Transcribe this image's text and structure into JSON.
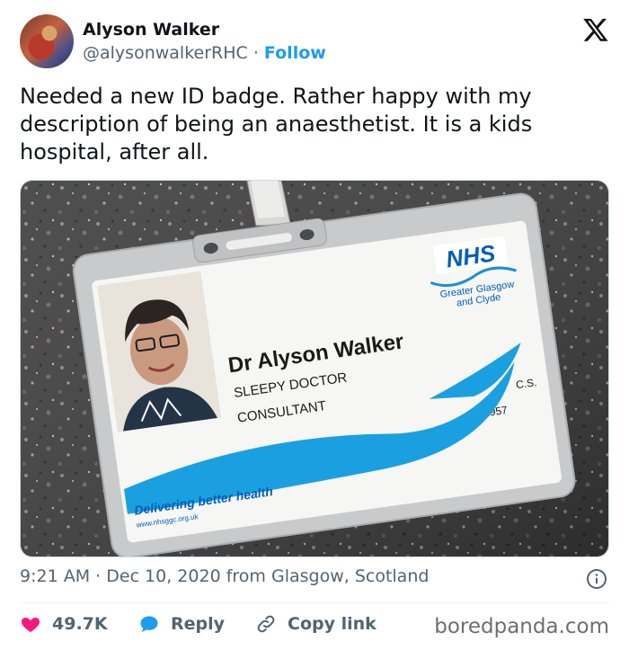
{
  "author": {
    "name": "Alyson Walker",
    "handle": "@alysonwalkerRHC",
    "separator": "·",
    "follow_label": "Follow"
  },
  "tweet": {
    "text": "Needed a new ID badge.  Rather happy with my description of being an anaesthetist. It is a kids hospital, after all."
  },
  "badge": {
    "org": "NHS",
    "org_sub_line1": "Greater Glasgow",
    "org_sub_line2": "and Clyde",
    "holder_name": "Dr Alyson Walker",
    "role_line1": "SLEEPY DOCTOR",
    "role_line2": "CONSULTANT",
    "code": "C.S.",
    "number": "1957",
    "slogan": "Delivering better health",
    "website": "www.nhsggc.org.uk"
  },
  "meta": {
    "time": "9:21 AM",
    "separator": "·",
    "date": "Dec 10, 2020",
    "location": "from Glasgow, Scotland"
  },
  "actions": {
    "likes": "49.7K",
    "reply_label": "Reply",
    "copy_label": "Copy link"
  },
  "watermark": "boredpanda.com",
  "colors": {
    "like": "#f91880",
    "reply": "#1d9bf0",
    "follow": "#1d9bf0",
    "nhs_blue": "#005eb8"
  }
}
